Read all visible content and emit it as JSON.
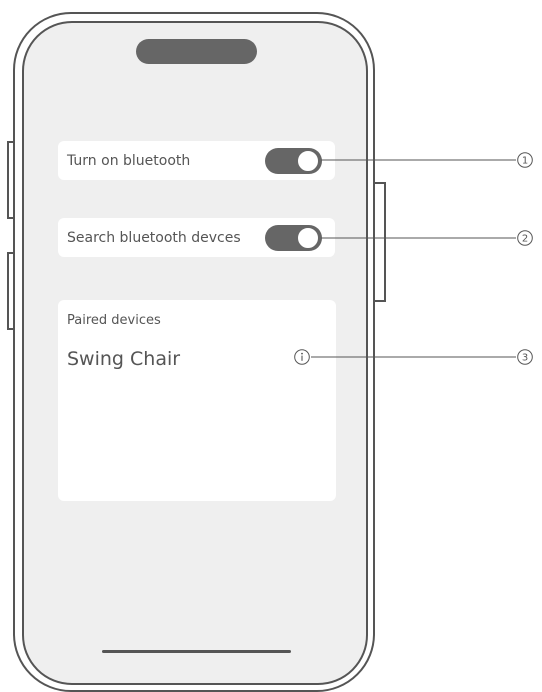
{
  "bluetooth_toggle": {
    "label": "Turn on bluetooth",
    "state": "on"
  },
  "search_toggle": {
    "label": "Search bluetooth devces",
    "state": "on"
  },
  "paired_devices": {
    "title": "Paired devices",
    "devices": [
      {
        "name": "Swing Chair",
        "icon": "info-icon"
      }
    ]
  },
  "callouts": [
    {
      "number": "1"
    },
    {
      "number": "2"
    },
    {
      "number": "3"
    }
  ]
}
